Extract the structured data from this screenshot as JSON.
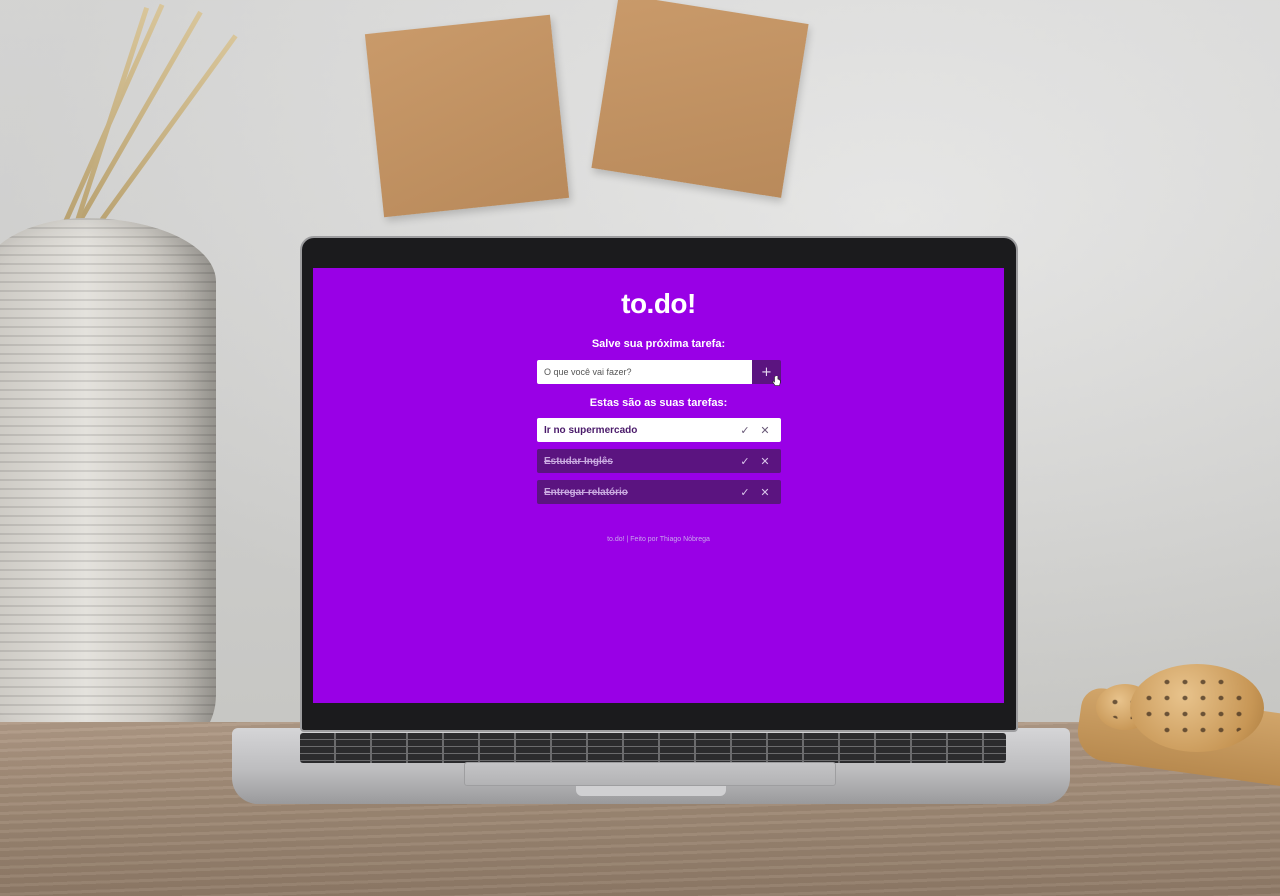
{
  "app": {
    "title": "to.do!",
    "new_task_label": "Salve sua próxima tarefa:",
    "task_input_placeholder": "O que você vai fazer?",
    "add_button_symbol": "+",
    "list_label": "Estas são as suas tarefas:",
    "complete_symbol": "✓",
    "delete_symbol": "✕",
    "tasks": [
      {
        "text": "Ir no supermercado",
        "completed": false
      },
      {
        "text": "Estudar Inglês",
        "completed": true
      },
      {
        "text": "Entregar relatório",
        "completed": true
      }
    ],
    "footer": "to.do! | Feito por Thiago Nóbrega"
  },
  "colors": {
    "background": "#9900e6",
    "accent_dark": "#5b1480",
    "text_light": "#ffffff"
  },
  "icons": {
    "add": "plus-icon",
    "complete": "check-icon",
    "delete": "close-icon",
    "pointer": "hand-cursor-icon"
  }
}
